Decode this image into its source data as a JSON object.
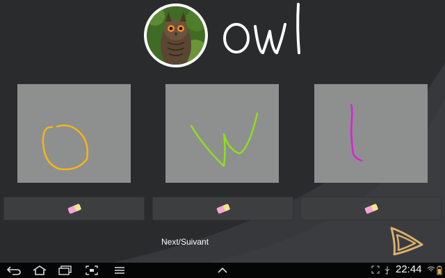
{
  "header": {
    "word": "owl",
    "photo_icon": "owl-photo"
  },
  "canvases": [
    {
      "letter": "o",
      "stroke_color": "#f2b619"
    },
    {
      "letter": "w",
      "stroke_color": "#8ee01c"
    },
    {
      "letter": "l",
      "stroke_color": "#e01ce0"
    }
  ],
  "erasers": [
    {
      "icon": "eraser-icon"
    },
    {
      "icon": "eraser-icon"
    },
    {
      "icon": "eraser-icon"
    }
  ],
  "footer": {
    "next_label": "Next/Suivant",
    "next_icon": "play-arrow-icon"
  },
  "navbar": {
    "buttons": [
      "back-icon",
      "home-icon",
      "recent-apps-icon",
      "screenshot-icon",
      "menu-icon",
      "chevron-up-icon"
    ],
    "status": {
      "time": "22:44"
    }
  },
  "colors": {
    "background": "#2a2b2d",
    "canvas": "#8e8f8f",
    "eraser_bar": "#3d3e40",
    "arrow": "#d9b06a"
  }
}
